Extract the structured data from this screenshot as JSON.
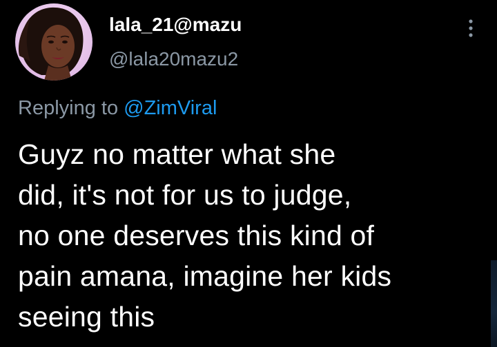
{
  "tweet": {
    "author": {
      "display_name": "lala_21@mazu",
      "handle": "@lala20mazu2"
    },
    "reply": {
      "prefix": "Replying to",
      "mention": "@ZimViral"
    },
    "text": "Guyz no matter what she\ndid, it's not for us to judge,\nno one deserves this kind of\npain amana, imagine her kids\nseeing this"
  },
  "icons": {
    "more": "more-vertical-icon",
    "avatar": "profile-avatar"
  },
  "colors": {
    "background": "#000000",
    "primary_text": "#ffffff",
    "secondary_text": "#8b98a5",
    "link": "#1d9bf0"
  }
}
